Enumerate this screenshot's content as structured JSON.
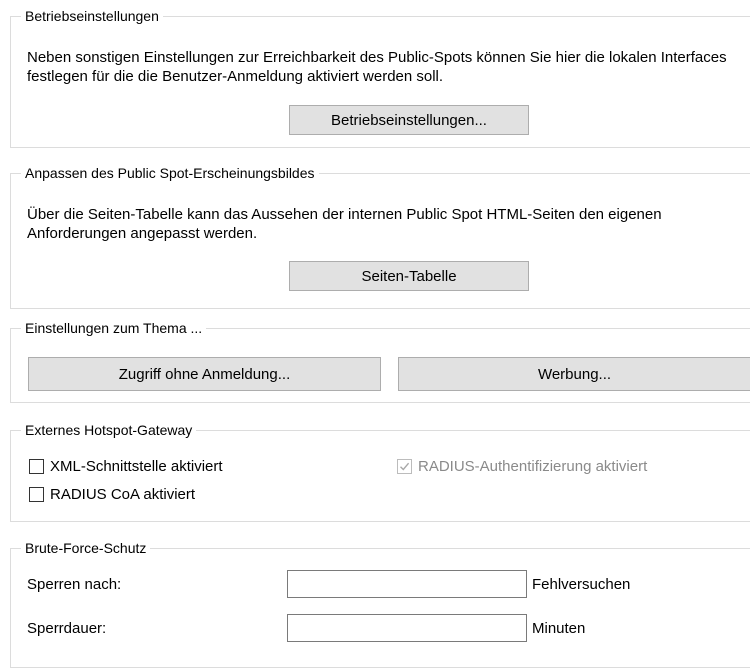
{
  "betrieb": {
    "legend": "Betriebseinstellungen",
    "description": "Neben sonstigen Einstellungen zur Erreichbarkeit des Public-Spots können Sie hier die lokalen Interfaces festlegen für die die Benutzer-Anmeldung aktiviert werden soll.",
    "button": "Betriebseinstellungen..."
  },
  "erscheinung": {
    "legend": "Anpassen des Public Spot-Erscheinungsbildes",
    "description": "Über die Seiten-Tabelle kann das Aussehen der internen Public Spot HTML-Seiten den eigenen Anforderungen angepasst werden.",
    "button": "Seiten-Tabelle"
  },
  "thema": {
    "legend": "Einstellungen zum Thema ...",
    "button_zugriff": "Zugriff ohne Anmeldung...",
    "button_werbung": "Werbung..."
  },
  "gateway": {
    "legend": "Externes Hotspot-Gateway",
    "xml_label": "XML-Schnittstelle aktiviert",
    "xml_checked": false,
    "radius_coa_label": "RADIUS CoA aktiviert",
    "radius_coa_checked": false,
    "radius_auth_label": "RADIUS-Authentifizierung aktiviert",
    "radius_auth_checked": true,
    "radius_auth_disabled": true
  },
  "bruteforce": {
    "legend": "Brute-Force-Schutz",
    "sperren_label": "Sperren nach:",
    "sperren_value": "",
    "sperren_unit": "Fehlversuchen",
    "dauer_label": "Sperrdauer:",
    "dauer_value": "",
    "dauer_unit": "Minuten"
  },
  "icons": {
    "check": "checkmark-icon"
  }
}
